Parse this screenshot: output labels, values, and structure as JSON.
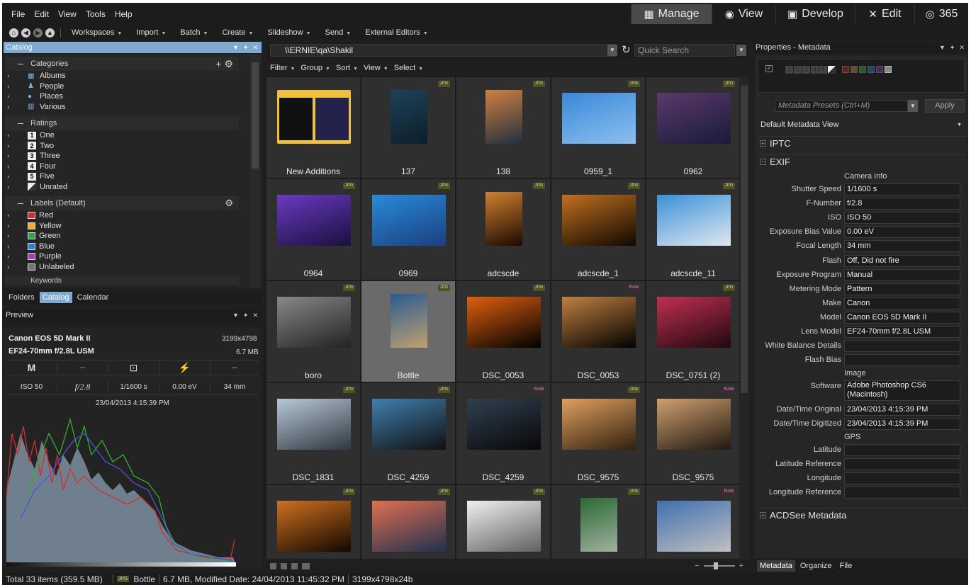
{
  "menu": [
    "File",
    "Edit",
    "View",
    "Tools",
    "Help"
  ],
  "modes": [
    {
      "icon": "grid-icon",
      "glyph": "▦",
      "label": "Manage"
    },
    {
      "icon": "eye-icon",
      "glyph": "◉",
      "label": "View"
    },
    {
      "icon": "photo-icon",
      "glyph": "▣",
      "label": "Develop"
    },
    {
      "icon": "tools-icon",
      "glyph": "✕",
      "label": "Edit"
    },
    {
      "icon": "365-icon",
      "glyph": "◎",
      "label": "365"
    }
  ],
  "toolbar": [
    "Workspaces",
    "Import",
    "Batch",
    "Create",
    "Slideshow",
    "Send",
    "External Editors"
  ],
  "catalog": {
    "title": "Catalog",
    "categories": {
      "title": "Categories",
      "items": [
        "Albums",
        "People",
        "Places",
        "Various"
      ]
    },
    "ratings": {
      "title": "Ratings",
      "items": [
        {
          "n": "1",
          "label": "One"
        },
        {
          "n": "2",
          "label": "Two"
        },
        {
          "n": "3",
          "label": "Three"
        },
        {
          "n": "4",
          "label": "Four"
        },
        {
          "n": "5",
          "label": "Five"
        },
        {
          "n": "",
          "label": "Unrated"
        }
      ]
    },
    "labels": {
      "title": "Labels (Default)",
      "items": [
        {
          "label": "Red",
          "color": "#d42a2a"
        },
        {
          "label": "Yellow",
          "color": "#f0b020"
        },
        {
          "label": "Green",
          "color": "#2aa844"
        },
        {
          "label": "Blue",
          "color": "#2a7fd4"
        },
        {
          "label": "Purple",
          "color": "#a040b0"
        },
        {
          "label": "Unlabeled",
          "color": "#777777"
        }
      ]
    },
    "keywords": "Keywords"
  },
  "left_tabs": [
    "Folders",
    "Catalog",
    "Calendar"
  ],
  "preview": {
    "title": "Preview",
    "camera": "Canon EOS 5D Mark II",
    "dims": "3199x4798",
    "lens": "EF24-70mm f/2.8L USM",
    "size": "6.7 MB",
    "mode": "M",
    "dash1": "--",
    "dash2": "--",
    "iso": "ISO 50",
    "aperture": "f/2.8",
    "shutter": "1/1600 s",
    "ev": "0.00 eV",
    "focal": "34 mm",
    "datetime": "23/04/2013 4:15:39 PM"
  },
  "path": "\\\\ERNIE\\qa\\Shakil",
  "quick_search": "Quick Search",
  "filterbar": [
    "Filter",
    "Group",
    "Sort",
    "View",
    "Select"
  ],
  "thumbs": [
    {
      "label": "New Additions",
      "badge": "",
      "type": "folder"
    },
    {
      "label": "137",
      "badge": "JPG",
      "c1": "#1d4258",
      "c2": "#0d1e2a",
      "orient": "p"
    },
    {
      "label": "138",
      "badge": "JPG",
      "c1": "#d08040",
      "c2": "#203040",
      "orient": "p"
    },
    {
      "label": "0959_1",
      "badge": "JPG",
      "c1": "#3a88d8",
      "c2": "#8cc0f0",
      "orient": "l"
    },
    {
      "label": "0962",
      "badge": "JPG",
      "c1": "#5a3a6a",
      "c2": "#1a1a3a",
      "orient": "l"
    },
    {
      "label": "0964",
      "badge": "JPG",
      "c1": "#6a3ac0",
      "c2": "#1a1040",
      "orient": "l"
    },
    {
      "label": "0969",
      "badge": "JPG",
      "c1": "#2a8ad8",
      "c2": "#1a4080",
      "orient": "l"
    },
    {
      "label": "adcscde",
      "badge": "JPG",
      "c1": "#d08030",
      "c2": "#1a0a00",
      "orient": "p"
    },
    {
      "label": "adcscde_1",
      "badge": "JPG",
      "c1": "#c07020",
      "c2": "#100800",
      "orient": "l"
    },
    {
      "label": "adcscde_11",
      "badge": "JPG",
      "c1": "#3a90d8",
      "c2": "#e0e8f0",
      "orient": "l"
    },
    {
      "label": "boro",
      "badge": "JPG",
      "c1": "#888888",
      "c2": "#222222",
      "orient": "l"
    },
    {
      "label": "Bottle",
      "badge": "JPG",
      "c1": "#2a5a90",
      "c2": "#c0a070",
      "orient": "p",
      "selected": true
    },
    {
      "label": "DSC_0053",
      "badge": "JPG",
      "c1": "#e06010",
      "c2": "#000000",
      "orient": "l"
    },
    {
      "label": "DSC_0053",
      "badge": "RAW",
      "c1": "#c08040",
      "c2": "#000000",
      "orient": "l"
    },
    {
      "label": "DSC_0751 (2)",
      "badge": "JPG",
      "c1": "#c03050",
      "c2": "#200810",
      "orient": "l"
    },
    {
      "label": "DSC_1831",
      "badge": "JPG",
      "c1": "#b8c8d8",
      "c2": "#303840",
      "orient": "l"
    },
    {
      "label": "DSC_4259",
      "badge": "JPG",
      "c1": "#4080b0",
      "c2": "#101010",
      "orient": "l"
    },
    {
      "label": "DSC_4259",
      "badge": "RAW",
      "c1": "#304050",
      "c2": "#080808",
      "orient": "l"
    },
    {
      "label": "DSC_9575",
      "badge": "JPG",
      "c1": "#e0a060",
      "c2": "#302010",
      "orient": "l"
    },
    {
      "label": "DSC_9575",
      "badge": "RAW",
      "c1": "#d0a070",
      "c2": "#201810",
      "orient": "l"
    },
    {
      "label": "",
      "badge": "JPG",
      "c1": "#d07020",
      "c2": "#100800",
      "orient": "l"
    },
    {
      "label": "",
      "badge": "JPG",
      "c1": "#e07050",
      "c2": "#203050",
      "orient": "l"
    },
    {
      "label": "",
      "badge": "JPG",
      "c1": "#f0f0f0",
      "c2": "#606060",
      "orient": "l"
    },
    {
      "label": "",
      "badge": "JPG",
      "c1": "#2a6a30",
      "c2": "#a0b0a0",
      "orient": "p"
    },
    {
      "label": "",
      "badge": "RAW",
      "c1": "#4070b0",
      "c2": "#c0c0c0",
      "orient": "l"
    }
  ],
  "props": {
    "title": "Properties - Metadata",
    "presets_placeholder": "Metadata Presets (Ctrl+M)",
    "apply": "Apply",
    "view": "Default Metadata View",
    "iptc": "IPTC",
    "exif": "EXIF",
    "acdsee": "ACDSee Metadata",
    "rating_nums": [
      "1",
      "2",
      "3",
      "4",
      "5"
    ],
    "label_colors": [
      "#6a2020",
      "#6a5020",
      "#2a5a2a",
      "#204a6a",
      "#4a2a5a",
      "#888888"
    ],
    "camera_info": "Camera Info",
    "image": "Image",
    "gps": "GPS",
    "fields_camera": [
      {
        "label": "Shutter Speed",
        "value": "1/1600 s"
      },
      {
        "label": "F-Number",
        "value": "f/2.8"
      },
      {
        "label": "ISO",
        "value": "ISO 50"
      },
      {
        "label": "Exposure Bias Value",
        "value": "0.00 eV"
      },
      {
        "label": "Focal Length",
        "value": "34 mm"
      },
      {
        "label": "Flash",
        "value": "Off, Did not fire"
      },
      {
        "label": "Exposure Program",
        "value": "Manual"
      },
      {
        "label": "Metering Mode",
        "value": "Pattern"
      },
      {
        "label": "Make",
        "value": "Canon"
      },
      {
        "label": "Model",
        "value": "Canon EOS 5D Mark II"
      },
      {
        "label": "Lens Model",
        "value": "EF24-70mm f/2.8L USM"
      },
      {
        "label": "White Balance Details",
        "value": ""
      },
      {
        "label": "Flash Bias",
        "value": ""
      }
    ],
    "software_label": "Software",
    "software_value": "Adobe Photoshop CS6 (Macintosh)",
    "fields_image": [
      {
        "label": "Date/Time Original",
        "value": "23/04/2013 4:15:39 PM"
      },
      {
        "label": "Date/Time Digitized",
        "value": "23/04/2013 4:15:39 PM"
      }
    ],
    "fields_gps": [
      {
        "label": "Latitude",
        "value": ""
      },
      {
        "label": "Latitude Reference",
        "value": ""
      },
      {
        "label": "Longitude",
        "value": ""
      },
      {
        "label": "Longitude Reference",
        "value": ""
      }
    ]
  },
  "right_tabs": [
    "Metadata",
    "Organize",
    "File"
  ],
  "status": {
    "total": "Total 33 items  (359.5 MB)",
    "badge": "JPG",
    "name": "Bottle",
    "info": "6.7 MB, Modified Date: 24/04/2013 11:45:32 PM",
    "dims": "3199x4798x24b"
  }
}
